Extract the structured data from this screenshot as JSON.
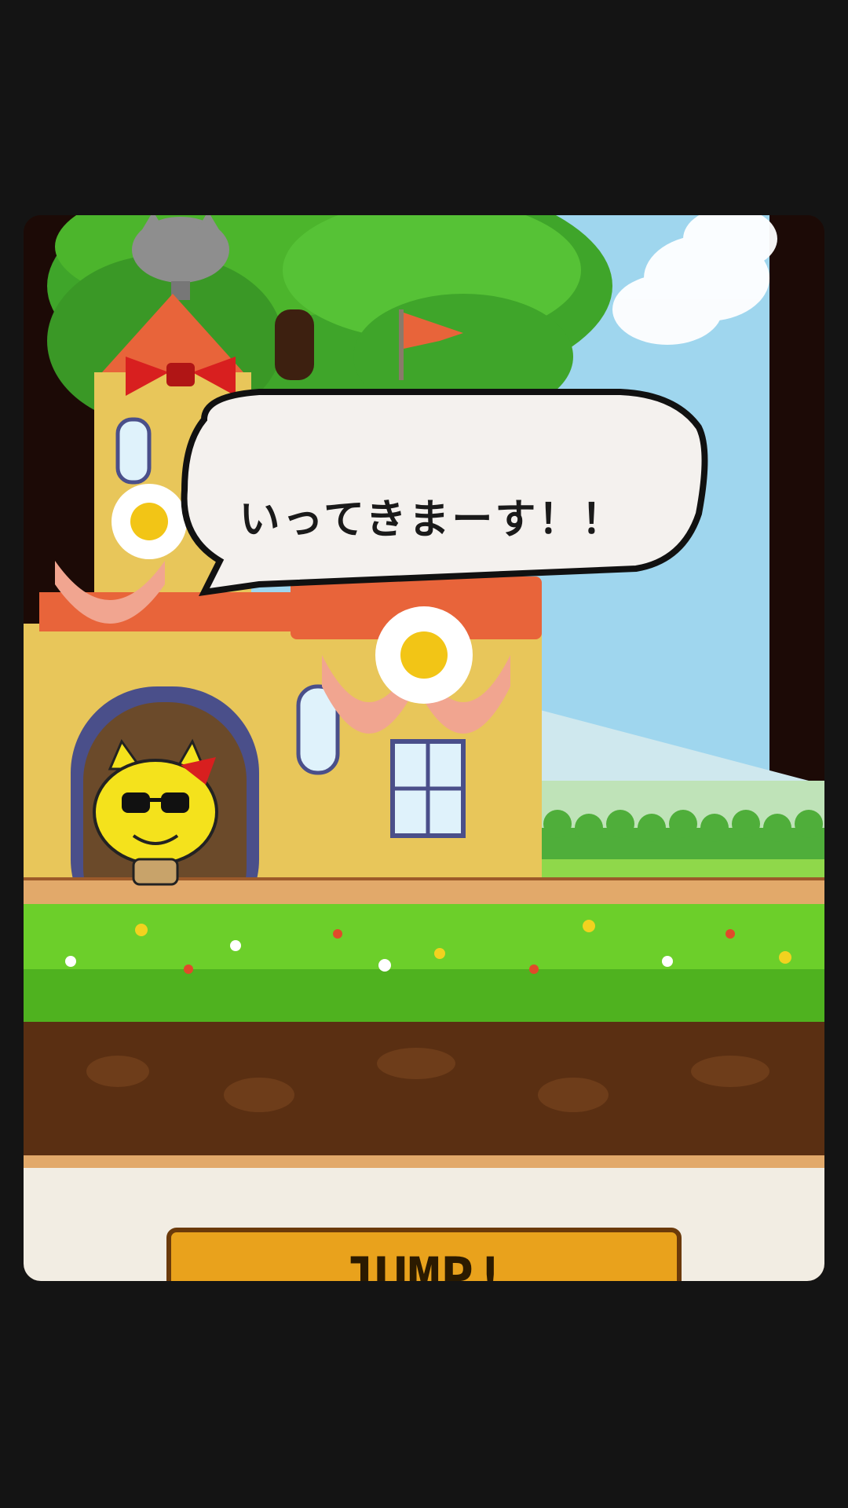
{
  "speech_bubble": {
    "text": "いってきまーす！！"
  },
  "controls": {
    "jump_label": "JUMP!"
  },
  "colors": {
    "sky": "#9fd6ee",
    "foliage": "#4cb52c",
    "grass": "#6ccf2a",
    "soil": "#5a2f12",
    "roof": "#e8643a",
    "castle_wall": "#e8c65a",
    "bow": "#d81f1f",
    "jump_button": "#e9a21c"
  },
  "icons": [
    "flag-icon",
    "flower-icon",
    "bow-icon",
    "cat-character",
    "cat-balloon-icon"
  ]
}
